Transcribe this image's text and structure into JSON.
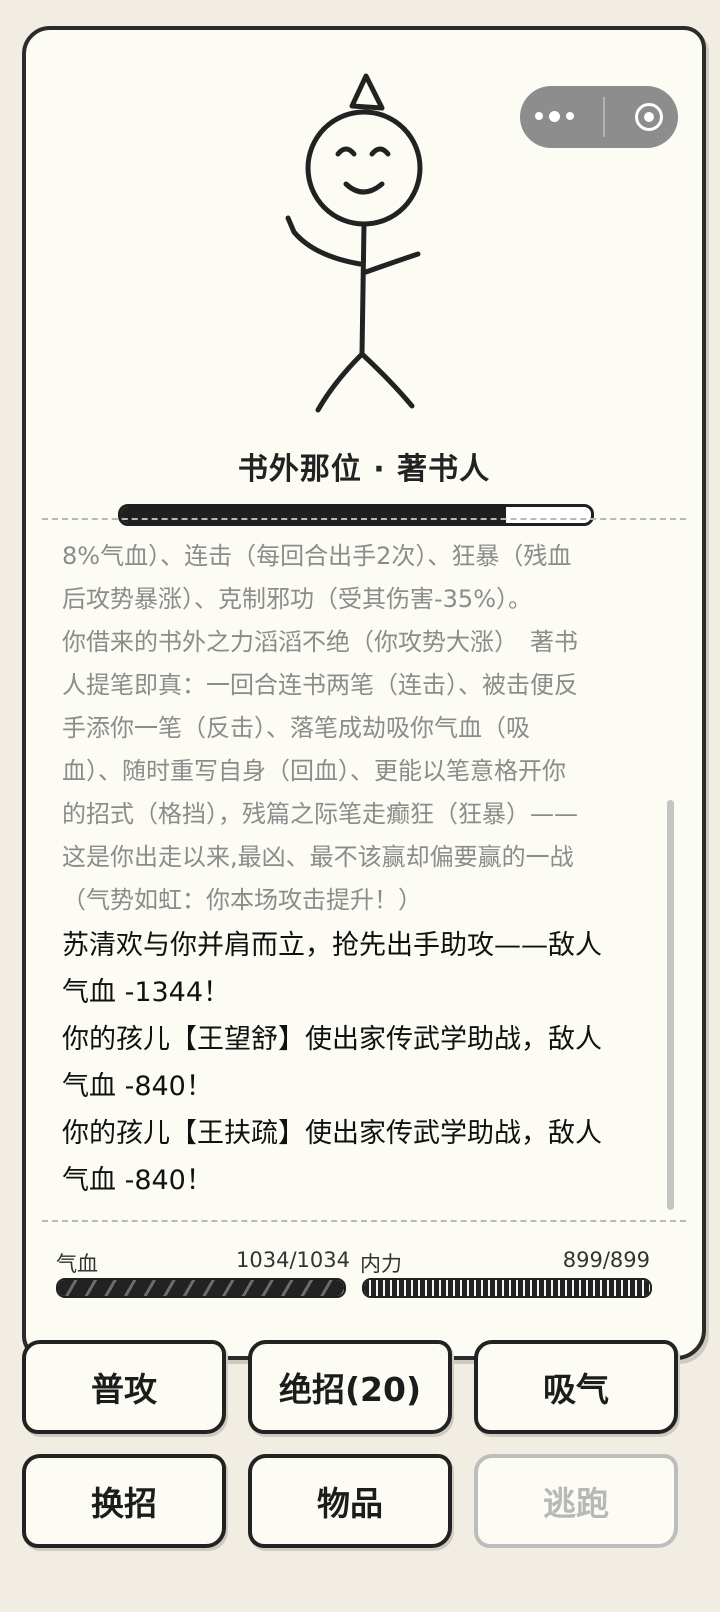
{
  "enemy": {
    "name": "书外那位 · 著书人",
    "hp_fraction": 0.82
  },
  "log": [
    {
      "type": "sys",
      "text": "8%气血）、连击（每回合出手2次）、狂暴（残血"
    },
    {
      "type": "sys",
      "text": "后攻势暴涨）、克制邪功（受其伤害-35%）。"
    },
    {
      "type": "sys",
      "text": "你借来的书外之力滔滔不绝（你攻势大涨）　著书"
    },
    {
      "type": "sys",
      "text": "人提笔即真：一回合连书两笔（连击）、被击便反"
    },
    {
      "type": "sys",
      "text": "手添你一笔（反击）、落笔成劫吸你气血（吸"
    },
    {
      "type": "sys",
      "text": "血）、随时重写自身（回血）、更能以笔意格开你"
    },
    {
      "type": "sys",
      "text": "的招式（格挡），残篇之际笔走癫狂（狂暴）——"
    },
    {
      "type": "sys",
      "text": "这是你出走以来,最凶、最不该赢却偏要赢的一战"
    },
    {
      "type": "sys",
      "text": "（气势如虹：你本场攻击提升！）"
    },
    {
      "type": "act",
      "text": "苏清欢与你并肩而立，抢先出手助攻——敌人"
    },
    {
      "type": "act",
      "text": "气血 -1344！"
    },
    {
      "type": "act",
      "text": "你的孩儿【王望舒】使出家传武学助战，敌人"
    },
    {
      "type": "act",
      "text": "气血 -840！"
    },
    {
      "type": "act",
      "text": "你的孩儿【王扶疏】使出家传武学助战，敌人"
    },
    {
      "type": "act",
      "text": "气血 -840！"
    }
  ],
  "player": {
    "hp_label": "气血",
    "hp_value": "1034/1034",
    "hp_fraction": 1.0,
    "mp_label": "内力",
    "mp_value": "899/899",
    "mp_fraction": 1.0
  },
  "actions": {
    "attack": "普攻",
    "ultimate": "绝招(20)",
    "breathe": "吸气",
    "switch": "换招",
    "items": "物品",
    "flee": "逃跑"
  },
  "icons": {
    "menu": "more-dots-icon",
    "close": "target-circle-icon"
  },
  "colors": {
    "background": "#f1ede3",
    "card": "#fcfbf4",
    "ink": "#222222",
    "muted_text": "#8c8c8c",
    "disabled": "#b8b8b8"
  }
}
